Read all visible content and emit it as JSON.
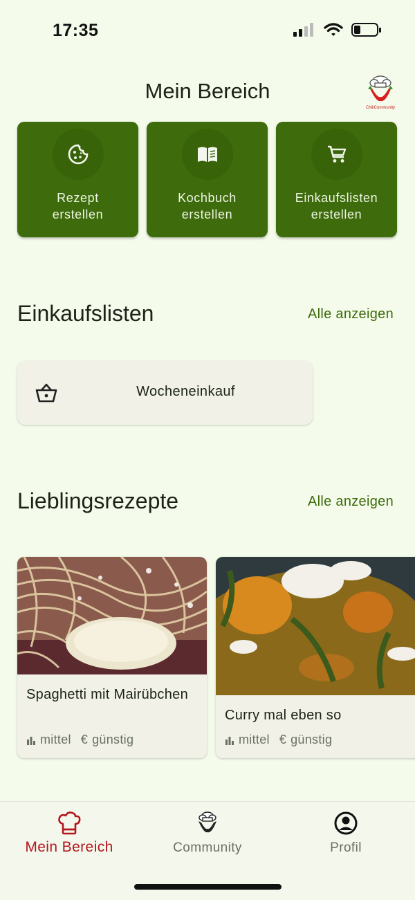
{
  "status": {
    "time": "17:35"
  },
  "header": {
    "title": "Mein Bereich",
    "logo_text": "ChiliCommunity"
  },
  "actions": [
    {
      "label": "Rezept\nerstellen",
      "icon": "cookie-icon"
    },
    {
      "label": "Kochbuch\nerstellen",
      "icon": "book-icon"
    },
    {
      "label": "Einkaufslisten\nerstellen",
      "icon": "cart-icon"
    }
  ],
  "shopping": {
    "title": "Einkaufslisten",
    "show_all": "Alle anzeigen",
    "items": [
      {
        "label": "Wocheneinkauf",
        "icon": "basket-icon"
      }
    ]
  },
  "favorites": {
    "title": "Lieblingsrezepte",
    "show_all": "Alle anzeigen",
    "recipes": [
      {
        "title": "Spaghetti mit Mairübchen",
        "difficulty": "mittel",
        "price": "günstig"
      },
      {
        "title": "Curry mal eben so",
        "difficulty": "mittel",
        "price": "günstig"
      }
    ]
  },
  "nav": {
    "items": [
      {
        "label": "Mein Bereich",
        "icon": "chef-hat-icon",
        "active": true
      },
      {
        "label": "Community",
        "icon": "community-logo-icon",
        "active": false
      },
      {
        "label": "Profil",
        "icon": "profile-icon",
        "active": false
      }
    ]
  },
  "colors": {
    "background": "#f4fbea",
    "primary": "#3e6b0b",
    "active_nav": "#b3161e",
    "card": "#f1f1e7"
  }
}
